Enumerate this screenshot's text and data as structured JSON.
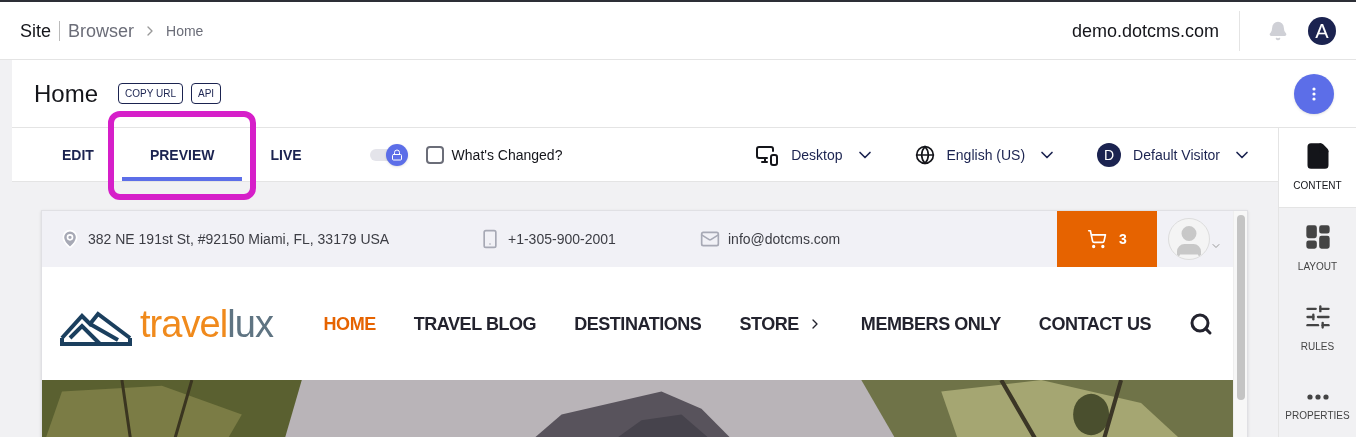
{
  "breadcrumb": {
    "site": "Site",
    "section": "Browser",
    "page": "Home"
  },
  "header": {
    "domain": "demo.dotcms.com",
    "avatar": "A"
  },
  "page": {
    "title": "Home",
    "actions": [
      "COPY URL",
      "API"
    ]
  },
  "modes": [
    {
      "label": "EDIT",
      "selected": false,
      "highlighted": false
    },
    {
      "label": "PREVIEW",
      "selected": true,
      "highlighted": true
    },
    {
      "label": "LIVE",
      "selected": false,
      "highlighted": false
    }
  ],
  "lock_toggle": {
    "on": true
  },
  "whats_changed": {
    "label": "What's Changed?",
    "checked": false
  },
  "selectors": [
    {
      "kind": "device",
      "label": "Desktop"
    },
    {
      "kind": "language",
      "label": "English (US)"
    },
    {
      "kind": "persona",
      "label": "Default Visitor",
      "initial": "D"
    }
  ],
  "sidebar": {
    "items": [
      {
        "kind": "content",
        "label": "CONTENT",
        "selected": true
      },
      {
        "kind": "layout",
        "label": "LAYOUT",
        "selected": false
      },
      {
        "kind": "rules",
        "label": "RULES",
        "selected": false
      },
      {
        "kind": "properties",
        "label": "PROPERTIES",
        "selected": false
      }
    ]
  },
  "site_preview": {
    "contacts": [
      {
        "kind": "address",
        "text": "382 NE 191st St, #92150 Miami, FL, 33179 USA"
      },
      {
        "kind": "phone",
        "text": "+1-305-900-2001"
      },
      {
        "kind": "email",
        "text": "info@dotcms.com"
      }
    ],
    "cart_count": "3",
    "logo_text": [
      "travel",
      "lux"
    ],
    "nav": [
      {
        "label": "HOME",
        "selected": true,
        "submenu": false
      },
      {
        "label": "TRAVEL BLOG",
        "selected": false,
        "submenu": false
      },
      {
        "label": "DESTINATIONS",
        "selected": false,
        "submenu": false
      },
      {
        "label": "STORE",
        "selected": false,
        "submenu": true
      },
      {
        "label": "MEMBERS ONLY",
        "selected": false,
        "submenu": false
      },
      {
        "label": "CONTACT US",
        "selected": false,
        "submenu": false
      }
    ],
    "hero": {
      "kind": "picture"
    }
  }
}
